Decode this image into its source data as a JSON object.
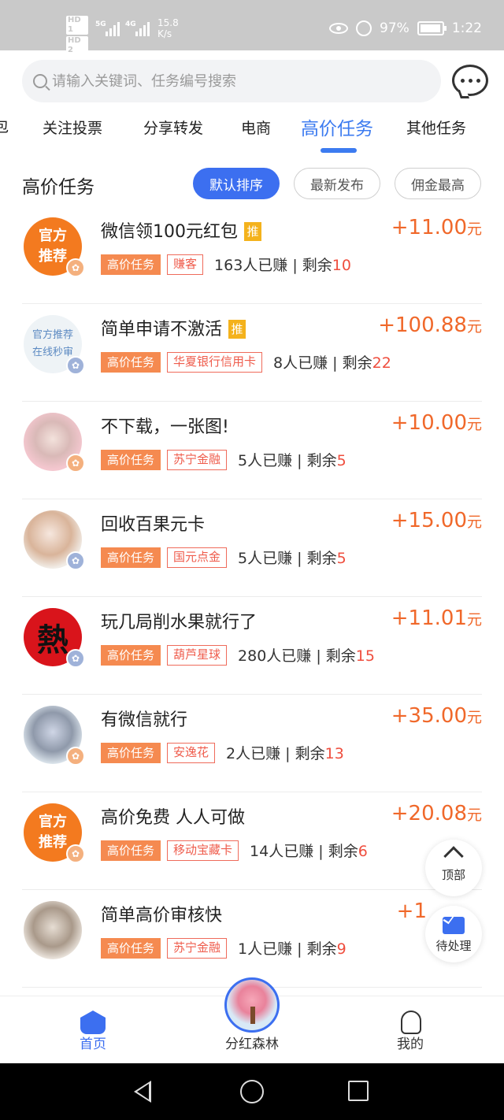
{
  "status_bar": {
    "hd1": "HD 1",
    "hd2": "HD 2",
    "net1": "5G",
    "net2": "4G",
    "speed_value": "15.8",
    "speed_unit": "K/s",
    "battery": "97%",
    "time": "1:22"
  },
  "search": {
    "placeholder": "请输入关键词、任务编号搜索"
  },
  "tabs": [
    {
      "label": "包"
    },
    {
      "label": "关注投票"
    },
    {
      "label": "分享转发"
    },
    {
      "label": "电商"
    },
    {
      "label": "高价任务"
    },
    {
      "label": "其他任务"
    }
  ],
  "section": {
    "title": "高价任务",
    "sort_options": [
      "默认排序",
      "最新发布",
      "佣金最高"
    ]
  },
  "tasks": [
    {
      "title": "微信领100元红包",
      "promo": "推",
      "avatar_text": "官方推荐",
      "price": "+11.00",
      "unit": "元",
      "tag_main": "高价任务",
      "tag_cat": "赚客",
      "earned": "163人已赚",
      "remain_label": "剩余",
      "remain": "10"
    },
    {
      "title": "简单申请不激活",
      "promo": "推",
      "avatar_text": "官方推荐 在线秒审",
      "price": "+100.88",
      "unit": "元",
      "tag_main": "高价任务",
      "tag_cat": "华夏银行信用卡",
      "earned": "8人已赚",
      "remain_label": "剩余",
      "remain": "22"
    },
    {
      "title": "不下载，一张图!",
      "price": "+10.00",
      "unit": "元",
      "tag_main": "高价任务",
      "tag_cat": "苏宁金融",
      "earned": "5人已赚",
      "remain_label": "剩余",
      "remain": "5"
    },
    {
      "title": "回收百果元卡",
      "price": "+15.00",
      "unit": "元",
      "tag_main": "高价任务",
      "tag_cat": "国元点金",
      "earned": "5人已赚",
      "remain_label": "剩余",
      "remain": "5"
    },
    {
      "title": "玩几局削水果就行了",
      "avatar_text": "熱",
      "price": "+11.01",
      "unit": "元",
      "tag_main": "高价任务",
      "tag_cat": "葫芦星球",
      "earned": "280人已赚",
      "remain_label": "剩余",
      "remain": "15"
    },
    {
      "title": "有微信就行",
      "price": "+35.00",
      "unit": "元",
      "tag_main": "高价任务",
      "tag_cat": "安逸花",
      "earned": "2人已赚",
      "remain_label": "剩余",
      "remain": "13"
    },
    {
      "title": "高价免费 人人可做",
      "avatar_text": "官方推荐",
      "price": "+20.08",
      "unit": "元",
      "tag_main": "高价任务",
      "tag_cat": "移动宝藏卡",
      "earned": "14人已赚",
      "remain_label": "剩余",
      "remain": "6"
    },
    {
      "title": "简单高价审核快",
      "price": "+1",
      "unit": "",
      "tag_main": "高价任务",
      "tag_cat": "苏宁金融",
      "earned": "1人已赚",
      "remain_label": "剩余",
      "remain": "9"
    }
  ],
  "floating": {
    "top_label": "顶部",
    "pending_label": "待处理"
  },
  "bottom_nav": [
    {
      "label": "首页"
    },
    {
      "label": "分红森林"
    },
    {
      "label": "我的"
    }
  ],
  "colors": {
    "accent": "#3c6ff0",
    "price": "#f0682a",
    "tag_main_bg": "#f58a50",
    "remain": "#ef4e3e"
  }
}
